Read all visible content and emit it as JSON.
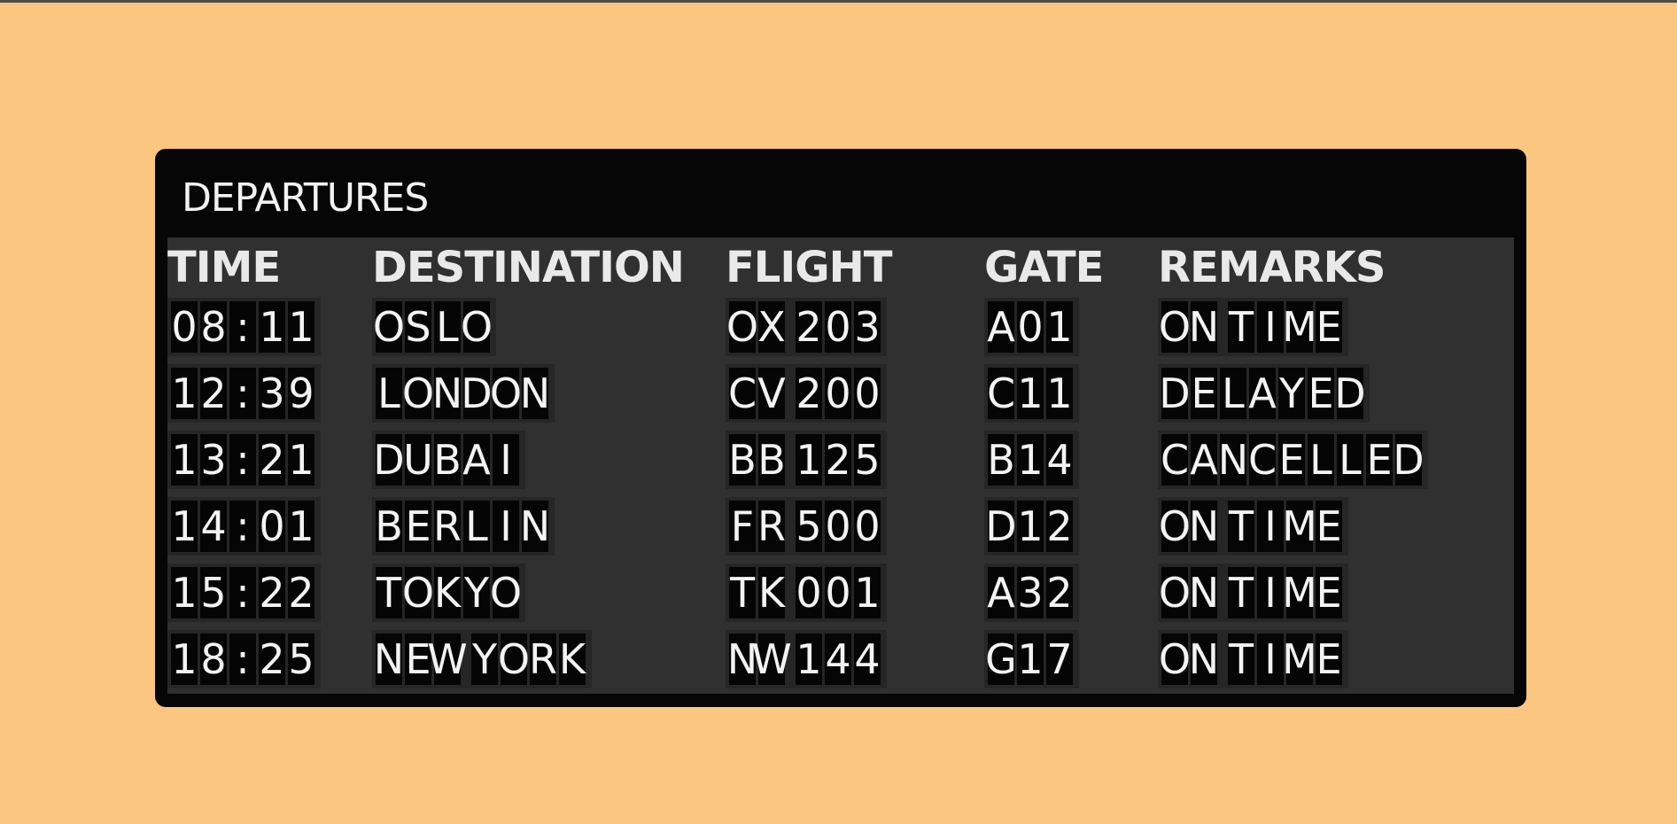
{
  "board": {
    "title": "DEPARTURES",
    "columns": {
      "time": "TIME",
      "destination": "DESTINATION",
      "flight": "FLIGHT",
      "gate": "GATE",
      "remarks": "REMARKS"
    },
    "rows": [
      {
        "time": "08:11",
        "destination": "OSLO",
        "flight": "OX 203",
        "gate": "A01",
        "remarks": "ON TIME"
      },
      {
        "time": "12:39",
        "destination": "LONDON",
        "flight": "CV 200",
        "gate": "C11",
        "remarks": "DELAYED"
      },
      {
        "time": "13:21",
        "destination": "DUBAI",
        "flight": "BB 125",
        "gate": "B14",
        "remarks": "CANCELLED"
      },
      {
        "time": "14:01",
        "destination": "BERLIN",
        "flight": "FR 500",
        "gate": "D12",
        "remarks": "ON TIME"
      },
      {
        "time": "15:22",
        "destination": "TOKYO",
        "flight": "TK 001",
        "gate": "A32",
        "remarks": "ON TIME"
      },
      {
        "time": "18:25",
        "destination": "NEW YORK",
        "flight": "NW 144",
        "gate": "G17",
        "remarks": "ON TIME"
      }
    ]
  },
  "colors": {
    "background": "#fbc67f",
    "board": "#060606",
    "panel": "#303030",
    "tile": "#050505",
    "text": "#f3f3f3"
  }
}
